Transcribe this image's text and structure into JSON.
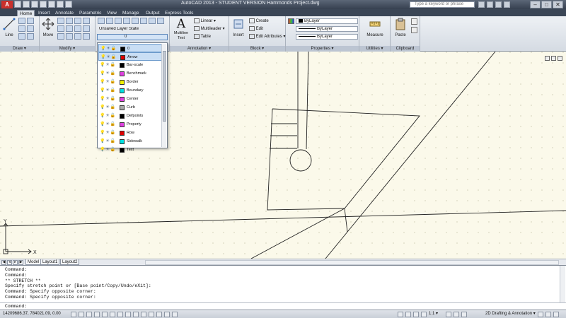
{
  "app": {
    "logo_letter": "A",
    "title": "AutoCAD 2013 - STUDENT VERSION    Hammonds Project.dwg",
    "search_placeholder": "Type a keyword or phrase"
  },
  "window_controls": [
    "–",
    "□",
    "✕"
  ],
  "tabs": [
    {
      "label": "Home",
      "active": true
    },
    {
      "label": "Insert"
    },
    {
      "label": "Annotate"
    },
    {
      "label": "Parametric"
    },
    {
      "label": "View"
    },
    {
      "label": "Manage"
    },
    {
      "label": "Output"
    },
    {
      "label": "Express Tools"
    }
  ],
  "ribbon": {
    "draw": {
      "title": "Draw ▾",
      "line": "Line"
    },
    "modify": {
      "title": "Modify ▾",
      "move": "Move"
    },
    "layers": {
      "state": "Unsaved Layer State",
      "current": "0"
    },
    "annotation": {
      "title": "Annotation ▾",
      "text": "Multiline\nText",
      "linear": "Linear ▾",
      "multileader": "Multileader ▾",
      "table": "Table"
    },
    "block": {
      "title": "Block ▾",
      "insert": "Insert",
      "create": "Create",
      "edit": "Edit",
      "edit_attributes": "Edit Attributes ▾"
    },
    "properties": {
      "title": "Properties ▾",
      "color": "ByLayer",
      "linetype": "ByLayer",
      "lineweight": "ByLayer"
    },
    "utilities": {
      "title": "Utilities ▾",
      "measure": "Measure"
    },
    "clipboard": {
      "title": "Clipboard",
      "paste": "Paste"
    }
  },
  "layers": [
    {
      "name": "0",
      "color": "#000000"
    },
    {
      "name": "Arrow",
      "color": "#e00000"
    },
    {
      "name": "Bar-scale",
      "color": "#000000"
    },
    {
      "name": "Benchmark",
      "color": "#e040e0"
    },
    {
      "name": "Border",
      "color": "#f0f000"
    },
    {
      "name": "Boundary",
      "color": "#00e0e0"
    },
    {
      "name": "Center",
      "color": "#e040e0"
    },
    {
      "name": "Curb",
      "color": "#a8a8a8"
    },
    {
      "name": "Defpoints",
      "color": "#000000"
    },
    {
      "name": "Property",
      "color": "#e040e0"
    },
    {
      "name": "Row",
      "color": "#e00000"
    },
    {
      "name": "Sidewalk",
      "color": "#00e0e0"
    },
    {
      "name": "Text",
      "color": "#000000"
    }
  ],
  "layout_tabs": [
    {
      "label": "Model",
      "active": true
    },
    {
      "label": "Layout1"
    },
    {
      "label": "Layout2"
    }
  ],
  "ucs": {
    "x": "X",
    "y": "Y"
  },
  "command_history": "Command:\nCommand:\n** STRETCH **\nSpecify stretch point or [Base point/Copy/Undo/eXit]:\nCommand: Specify opposite corner:\nCommand: Specify opposite corner:",
  "command_prompt": "Command:",
  "status": {
    "coords": "14209686.37, 784021.09, 0.00",
    "scale": "1:1 ▾",
    "workspace": "2D Drafting & Annotation ▾"
  }
}
